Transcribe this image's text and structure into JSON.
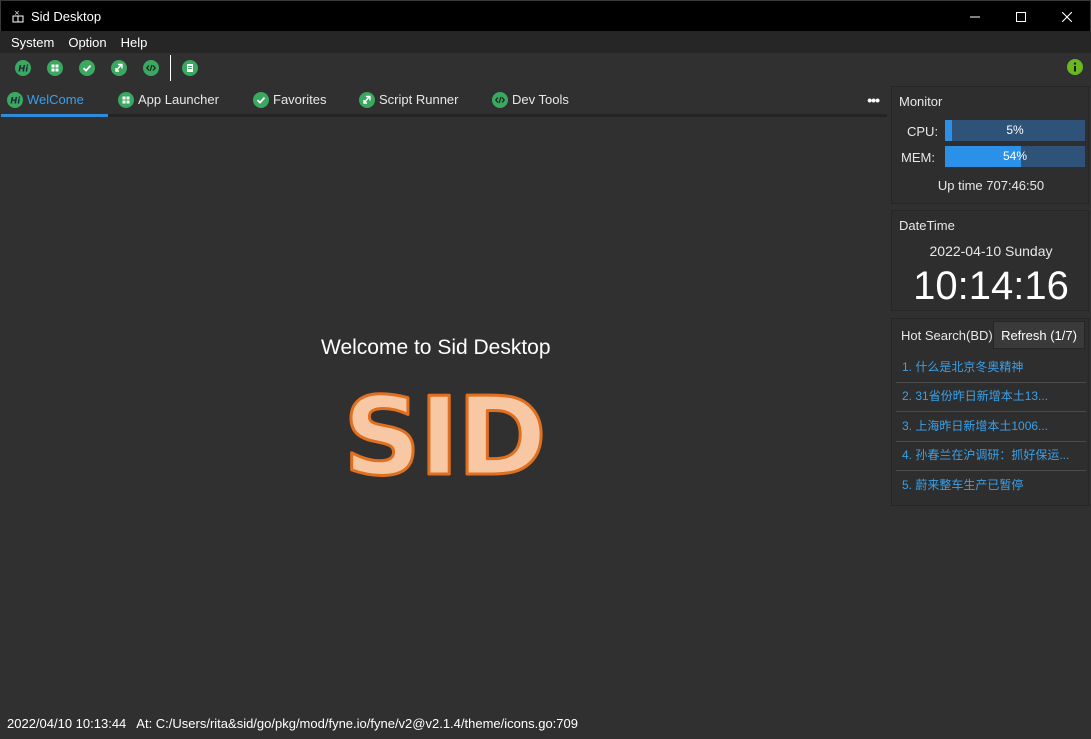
{
  "window": {
    "title": "Sid Desktop"
  },
  "menu": [
    "System",
    "Option",
    "Help"
  ],
  "toolbar": {
    "icons": [
      "hi-icon",
      "apps-icon",
      "check-icon",
      "script-icon",
      "code-icon",
      "doc-icon"
    ],
    "info_icon": "info-icon"
  },
  "tabs": [
    {
      "label": "WelCome",
      "icon": "hi-icon",
      "active": true
    },
    {
      "label": "App Launcher",
      "icon": "apps-icon",
      "active": false
    },
    {
      "label": "Favorites",
      "icon": "check-icon",
      "active": false
    },
    {
      "label": "Script Runner",
      "icon": "script-icon",
      "active": false
    },
    {
      "label": "Dev Tools",
      "icon": "code-icon",
      "active": false
    }
  ],
  "welcome": {
    "title": "Welcome to Sid Desktop",
    "logo_text": "SID"
  },
  "monitor": {
    "title": "Monitor",
    "cpu_label": "CPU:",
    "cpu_value": "5%",
    "cpu_percent": 5,
    "mem_label": "MEM:",
    "mem_value": "54%",
    "mem_percent": 54,
    "uptime": "Up time 707:46:50"
  },
  "datetime": {
    "title": "DateTime",
    "date": "2022-04-10 Sunday",
    "time": "10:14:16"
  },
  "hot_search": {
    "title": "Hot Search(BD)",
    "refresh_label": "Refresh (1/7)",
    "items": [
      "1.  什么是北京冬奥精神",
      "2.  31省份昨日新增本土13...",
      "3.  上海昨日新增本土1006...",
      "4.  孙春兰在沪调研：抓好保运...",
      "5.  蔚来整车生产已暂停"
    ]
  },
  "status": {
    "timestamp": "2022/04/10 10:13:44",
    "message": "At: C:/Users/rita&sid/go/pkg/mod/fyne.io/fyne/v2@v2.1.4/theme/icons.go:709"
  },
  "colors": {
    "accent": "#2d8cdc",
    "icon_green": "#3aa860",
    "logo_fill": "#f8c8a4",
    "logo_stroke": "#e07020",
    "info_green": "#6ab820"
  }
}
